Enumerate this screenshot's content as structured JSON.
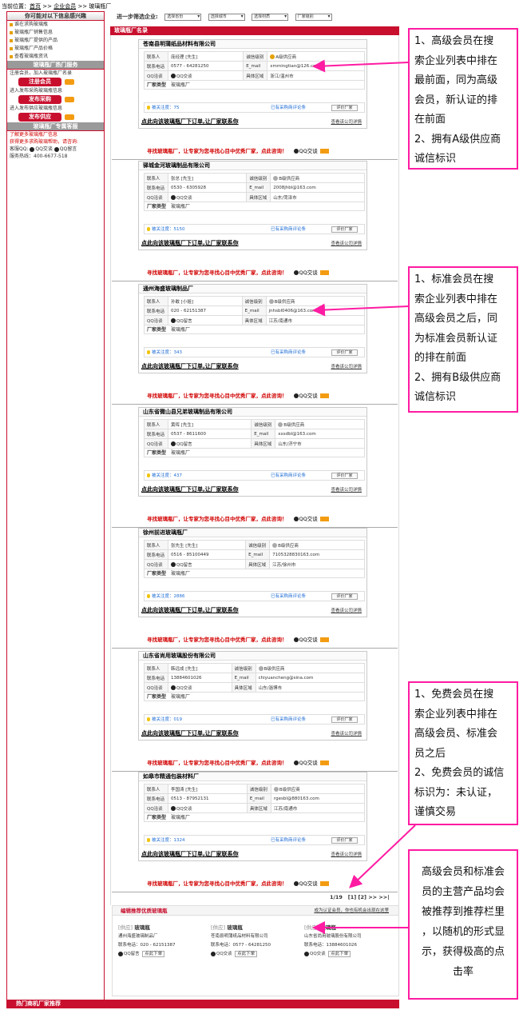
{
  "breadcrumb": {
    "prefix": "当前位置：",
    "home": "首页",
    "sep1": ">>",
    "section": "企业会员",
    "sep2": ">>",
    "current": "玻璃瓶厂"
  },
  "sidebar": {
    "header1": "你可能对以下信息感兴趣",
    "links": [
      "谁在求购玻璃瓶",
      "玻璃瓶厂销售信息",
      "玻璃瓶厂提供的产品",
      "玻璃瓶厂产品价格",
      "查看玻璃瓶资讯"
    ],
    "header2": "玻璃瓶厂热门服务",
    "reg_text": "注册会员，加入玻璃瓶厂名录",
    "reg_btn": "注册会员",
    "buy_text": "进入发布采购玻璃瓶信息",
    "buy_btn": "发布采购",
    "sup_text": "进入发布供应玻璃瓶信息",
    "sup_btn": "发布供应",
    "header3": "玻璃瓶厂专属客服",
    "cs1": "了解更多玻璃瓶厂信息",
    "cs2": "获得更多求购玻璃帮助，请咨询:",
    "cs3_label": "客服QQ:",
    "cs3_a": "QQ交谈",
    "cs3_b": "QQ留言",
    "cs4": "服务热线：400-6677-518"
  },
  "filter": {
    "label": "进一步筛选企业:",
    "opt1": "选择省份",
    "opt2": "选择城市",
    "opt3": "选择材质",
    "opt4": "厂家级别"
  },
  "list_title": "玻璃瓶厂名录",
  "labels": {
    "contact": "联系人",
    "level": "诚信级别",
    "phone": "联系电话",
    "email": "E_mail",
    "qq": "QQ洽谈",
    "area": "具体区域",
    "type": "厂家类型",
    "pop": "被关注度：",
    "eval": "已有采购商评论条",
    "rate": "评价厂家",
    "order": "点此向该玻璃瓶厂下订单,让厂家联系你",
    "more": "查看该公司详情"
  },
  "companies": [
    {
      "name": "苍南县明蒲纸品材料有限公司",
      "contact": "庞经理 [先生]",
      "level": "A级供应商",
      "phone": "0577 - 64281250",
      "email": "xmmingtian@126.com",
      "qq": "QQ交谈",
      "area": "浙江/温州市",
      "type": "玻璃瓶厂",
      "pop": "75"
    },
    {
      "name": "驿城金河玻璃制品有限公司",
      "contact": "张总 [先生]",
      "level": "B级供应商",
      "phone": "0530 - 6305928",
      "email": "2008jhbl@163.com",
      "qq": "QQ交谈",
      "area": "山东/菏泽市",
      "type": "玻璃瓶厂",
      "pop": "5150"
    },
    {
      "name": "通州海盛玻璃制品厂",
      "contact": "孙敢 [小姐]",
      "level": "B级供应商",
      "phone": "020 - 62151387",
      "email": "jnhsbl0406@163.com",
      "qq": "QQ留言",
      "area": "江苏/南通市",
      "type": "玻璃瓶厂",
      "pop": "343"
    },
    {
      "name": "山东省微山县兄弟玻璃制品有限公司",
      "contact": "黄晖 [先生]",
      "level": "B级供应商",
      "phone": "0537 - 8611600",
      "email": "xxsdbl@163.com",
      "qq": "QQ留言",
      "area": "山东/济宁市",
      "type": "玻璃瓶厂",
      "pop": "437"
    },
    {
      "name": "徐州前进玻璃瓶厂",
      "contact": "张先生 [先生]",
      "level": "B级供应商",
      "phone": "0516 - 85100449",
      "email": "7105328830163.com",
      "qq": "QQ留言",
      "area": "江苏/徐州市",
      "type": "玻璃瓶厂",
      "pop": "2886"
    },
    {
      "name": "山东省尚用玻璃股份有限公司",
      "contact": "韩远成 [先生]",
      "level": "B级供应商",
      "phone": "13884601026",
      "email": "chiyuancheng@sina.com",
      "qq": "QQ交谈",
      "area": "山东/淄博市",
      "type": "玻璃瓶厂",
      "pop": "019"
    },
    {
      "name": "如皋市精通包装材料厂",
      "contact": "李国涛 [先生]",
      "level": "B级供应商",
      "phone": "0513 - 87952131",
      "email": "rgesbl@880163.com",
      "qq": "QQ交谈",
      "area": "江苏/南通市",
      "type": "玻璃瓶厂",
      "pop": "1324"
    }
  ],
  "banner": {
    "text": "寻找玻璃瓶厂，让专家为您寻找心目中优秀厂家，点此咨询！",
    "qq": "QQ交谈"
  },
  "pager": {
    "page": "1/19",
    "links": "[1] [2] >> >>|"
  },
  "recommend": {
    "title": "编辑推荐优质玻璃瓶",
    "right": "成为认证会员，你也有机会出现在这里",
    "items": [
      {
        "tag": "[供应]",
        "product": "玻璃瓶",
        "company": "通州海盛玻璃制品厂",
        "phone": "联系电话：020 - 62151387",
        "qq": "QQ留言",
        "btn": "点此下单"
      },
      {
        "tag": "[供应]",
        "product": "玻璃瓶",
        "company": "苍南县明蒲纸品材料有限公司",
        "phone": "联系电话：0577 - 64281250",
        "qq": "QQ交谈",
        "btn": "点此下单"
      },
      {
        "tag": "[供应]",
        "product": "玻璃瓶",
        "company": "山东省尚用玻璃股份有限公司",
        "phone": "联系电话：13884601026",
        "qq": "QQ交谈",
        "btn": "点此下单"
      }
    ]
  },
  "hot": "热门商机厂家推荐",
  "notes": [
    {
      "lines": [
        "1、高级会员在搜",
        "索企业列表中排在",
        "最前面，同为高级",
        "会员，新认证的排",
        "在前面",
        "2、拥有A级供应商",
        "诚信标识"
      ]
    },
    {
      "lines": [
        "1、标准会员在搜",
        "索企业列表中排在",
        "高级会员之后，同",
        "为标准会员新认证",
        "的排在前面",
        "2、拥有B级供应商",
        "诚信标识"
      ]
    },
    {
      "lines": [
        "1、免费会员在搜",
        "索企业列表中排在",
        "高级会员、标准会",
        "员之后",
        "2、免费会员的诚信",
        "标识为：未认证，",
        "谨慎交易"
      ]
    },
    {
      "lines": [
        "高级会员和标准会",
        "员的主营产品均会",
        "被推荐到推荐栏里",
        "，以随机的形式显",
        "示，获得极高的点",
        "击率"
      ]
    }
  ],
  "colors": {
    "accent": "#c8102e",
    "note_border": "#ff1ba2",
    "banner_text": "#d10000"
  }
}
